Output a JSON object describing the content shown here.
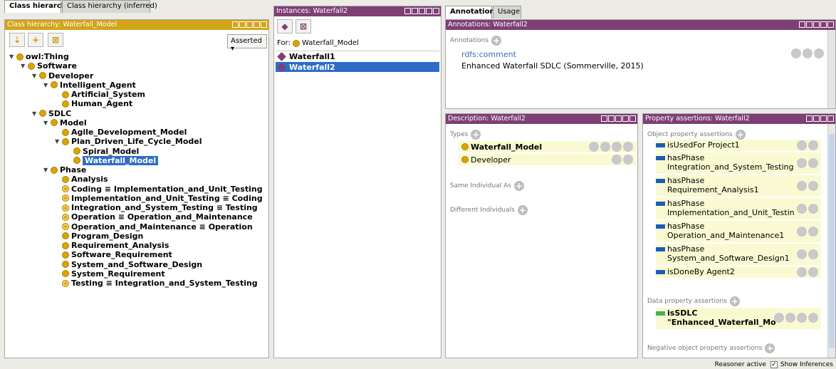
{
  "left_tabs": [
    "Class hierarchy",
    "Class hierarchy (inferred)"
  ],
  "class_panel": {
    "title": "Class hierarchy: Waterfall_Model",
    "mode_select": "Asserted",
    "tree": [
      {
        "label": "owl:Thing",
        "level": 0,
        "toggle": "▼"
      },
      {
        "label": "Software",
        "level": 1,
        "toggle": "▼"
      },
      {
        "label": "Developer",
        "level": 2,
        "toggle": "▼"
      },
      {
        "label": "Intelligent_Agent",
        "level": 3,
        "toggle": "▼"
      },
      {
        "label": "Artificial_System",
        "level": 4,
        "toggle": ""
      },
      {
        "label": "Human_Agent",
        "level": 4,
        "toggle": ""
      },
      {
        "label": "SDLC",
        "level": 2,
        "toggle": "▼"
      },
      {
        "label": "Model",
        "level": 3,
        "toggle": "▼"
      },
      {
        "label": "Agile_Development_Model",
        "level": 4,
        "toggle": ""
      },
      {
        "label": "Plan_Driven_Life_Cycle_Model",
        "level": 4,
        "toggle": "▼"
      },
      {
        "label": "Spiral_Model",
        "level": 5,
        "toggle": ""
      },
      {
        "label": "Waterfall_Model",
        "level": 5,
        "toggle": "",
        "selected": true
      },
      {
        "label": "Phase",
        "level": 3,
        "toggle": "▼"
      },
      {
        "label": "Analysis",
        "level": 4,
        "toggle": ""
      },
      {
        "label": "Coding ≡ Implementation_and_Unit_Testing",
        "level": 4,
        "toggle": "",
        "eq": true
      },
      {
        "label": "Implementation_and_Unit_Testing ≡ Coding",
        "level": 4,
        "toggle": "",
        "eq": true
      },
      {
        "label": "Integration_and_System_Testing ≡ Testing",
        "level": 4,
        "toggle": "",
        "eq": true
      },
      {
        "label": "Operation ≡ Operation_and_Maintenance",
        "level": 4,
        "toggle": "",
        "eq": true
      },
      {
        "label": "Operation_and_Maintenance ≡ Operation",
        "level": 4,
        "toggle": "",
        "eq": true
      },
      {
        "label": "Program_Design",
        "level": 4,
        "toggle": ""
      },
      {
        "label": "Requirement_Analysis",
        "level": 4,
        "toggle": ""
      },
      {
        "label": "Software_Requirement",
        "level": 4,
        "toggle": ""
      },
      {
        "label": "System_and_Software_Design",
        "level": 4,
        "toggle": ""
      },
      {
        "label": "System_Requirement",
        "level": 4,
        "toggle": ""
      },
      {
        "label": "Testing ≡ Integration_and_System_Testing",
        "level": 4,
        "toggle": "",
        "eq": true
      }
    ]
  },
  "instances": {
    "title": "Instances: Waterfall2",
    "for_label": "For:",
    "for_class": "Waterfall_Model",
    "items": [
      "Waterfall1",
      "Waterfall2"
    ],
    "selected": "Waterfall2"
  },
  "right_tabs": [
    "Annotations",
    "Usage"
  ],
  "annotations": {
    "title": "Annotations: Waterfall2",
    "section": "Annotations",
    "property": "rdfs:comment",
    "value": "Enhanced Waterfall SDLC (Sommerville, 2015)"
  },
  "description": {
    "title": "Description: Waterfall2",
    "types_label": "Types",
    "types": [
      "Waterfall_Model",
      "Developer"
    ],
    "same_label": "Same Individual As",
    "different_label": "Different Individuals"
  },
  "property_assertions": {
    "title": "Property assertions: Waterfall2",
    "object_label": "Object property assertions",
    "object": [
      {
        "line1": "isUsedFor  Project1",
        "line2": ""
      },
      {
        "line1": "hasPhase",
        "line2": "Integration_and_System_Testing"
      },
      {
        "line1": "hasPhase",
        "line2": "Requirement_Analysis1"
      },
      {
        "line1": "hasPhase",
        "line2": "Implementation_and_Unit_Testin"
      },
      {
        "line1": "hasPhase",
        "line2": "Operation_and_Maintenance1"
      },
      {
        "line1": "hasPhase",
        "line2": "System_and_Software_Design1"
      },
      {
        "line1": "isDoneBy  Agent2",
        "line2": ""
      }
    ],
    "data_label": "Data property assertions",
    "data_prop": "isSDLC",
    "data_value": "\"Enhanced_Waterfall_Mo",
    "negative_label": "Negative object property assertions"
  },
  "status": {
    "reasoner": "Reasoner active",
    "show_inferences": "Show Inferences"
  }
}
